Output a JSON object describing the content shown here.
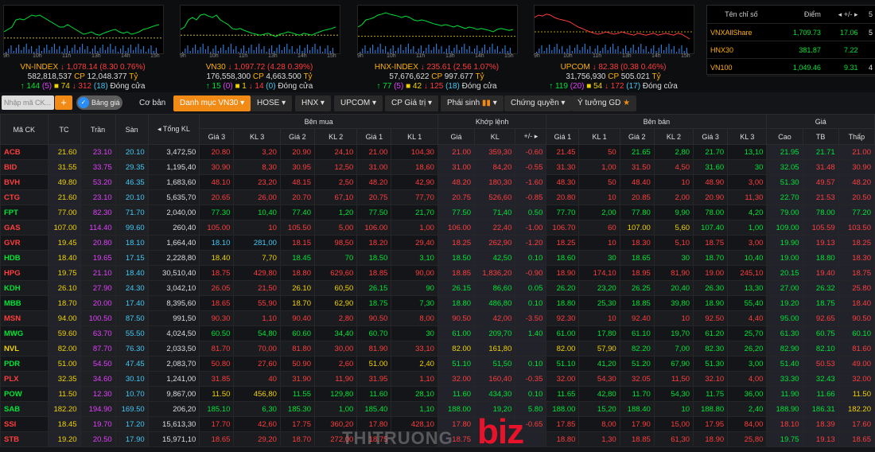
{
  "indices": [
    {
      "id": "vnindex",
      "times": [
        "9h",
        "10h",
        "11h",
        "13h",
        "14h",
        "15h"
      ],
      "ref_ratio": 0.32,
      "line": "0.55,0.50,0.45,0.30,0.28,0.30,0.25,0.20,0.22,0.20,0.25,0.30,0.35,0.40,0.45,0.45,0.40,0.45,0.50,0.55,0.60,0.58,0.55,0.60,0.62,0.58,0.55,0.52,0.50,0.55,0.58,0.55,0.60,0.58,0.55,0.50,0.48,0.45,0.42,0.40",
      "name": "VN-INDEX",
      "value": "1,078.14",
      "change": "(8.30 0.76%)",
      "volume": "582,818,537",
      "value_label": "CP",
      "turnover": "12,048.377",
      "unit": "Tỷ",
      "up": "144",
      "ceil": "(5)",
      "ref": "74",
      "down": "312",
      "floor": "(18)",
      "status": "Đóng cửa"
    },
    {
      "id": "vn30",
      "times": [
        "9h",
        "10h",
        "11h",
        "13h",
        "14h",
        "15h"
      ],
      "ref_ratio": 0.38,
      "line": "0.50,0.45,0.30,0.25,0.30,0.20,0.18,0.22,0.25,0.20,0.30,0.35,0.40,0.48,0.50,0.48,0.52,0.55,0.58,0.60,0.62,0.60,0.58,0.62,0.65,0.60,0.58,0.55,0.57,0.60,0.62,0.58,0.60,0.62,0.58,0.55,0.52,0.50,0.48,0.45",
      "name": "VN30",
      "value": "1,097.72",
      "change": "(4.28 0.39%)",
      "volume": "176,558,300",
      "value_label": "CP",
      "turnover": "4,663.500",
      "unit": "Tỷ",
      "up": "15",
      "ceil": "(0)",
      "ref": "1",
      "down": "14",
      "floor": "(0)",
      "status": "Đóng cửa"
    },
    {
      "id": "hnxindex",
      "times": [
        "9h",
        "10h",
        "11h",
        "13h",
        "14h",
        "15h"
      ],
      "ref_ratio": 0.36,
      "line": "0.45,0.40,0.30,0.28,0.25,0.20,0.18,0.15,0.18,0.20,0.22,0.25,0.22,0.25,0.30,0.32,0.30,0.32,0.35,0.38,0.40,0.42,0.40,0.42,0.45,0.42,0.45,0.48,0.45,0.47,0.50,0.48,0.50,0.52,0.55,0.50,0.48,0.50,0.52,0.50",
      "name": "HNX-INDEX",
      "value": "235.61",
      "change": "(2.56 1.07%)",
      "volume": "57,676,622",
      "value_label": "CP",
      "turnover": "997.677",
      "unit": "Tỷ",
      "up": "77",
      "ceil": "(5)",
      "ref": "42",
      "down": "125",
      "floor": "(18)",
      "status": "Đóng cửa"
    },
    {
      "id": "upcom",
      "times": [
        "9h",
        "10h",
        "11h",
        "13h",
        "14h",
        "15h"
      ],
      "ref_ratio": 0.45,
      "line": "0.25,0.20,0.22,0.18,0.20,0.25,0.28,0.30,0.32,0.35,0.40,0.45,0.48,0.52,0.55,0.58,0.60,0.58,0.55,0.58,0.60,0.58,0.55,0.58,0.60,0.62,0.58,0.60,0.62,0.60,0.58,0.62,0.60,0.58,0.60,0.62,0.58,0.60,0.65,0.70",
      "name": "UPCOM",
      "value": "82.38",
      "change": "(0.38 0.46%)",
      "volume": "31,756,930",
      "value_label": "CP",
      "turnover": "505.021",
      "unit": "Tỷ",
      "up": "119",
      "ceil": "(20)",
      "ref": "54",
      "down": "172",
      "floor": "(17)",
      "status": "Đóng cửa"
    }
  ],
  "side_panel": {
    "headers": [
      "Tên chỉ số",
      "Điểm",
      "+/-",
      "5"
    ],
    "rows": [
      {
        "name": "VNXAllShare",
        "point": "1,709.73",
        "change": "17.06",
        "extra": "5"
      },
      {
        "name": "HNX30",
        "point": "381.87",
        "change": "7.22",
        "extra": ""
      },
      {
        "name": "VN100",
        "point": "1,049.46",
        "change": "9.31",
        "extra": "4"
      }
    ]
  },
  "toolbar": {
    "search_placeholder": "Nhập mã CK...",
    "plus_label": "+",
    "toggle_label": "Bảng giá",
    "basic_label": "Cơ bản",
    "active_tab": "Danh mục VN30",
    "tabs": [
      "HOSE",
      "HNX",
      "UPCOM",
      "CP Giá trị",
      "Phái sinh",
      "Chứng quyền"
    ],
    "idea_label": "Ý tưởng GD"
  },
  "table": {
    "groups": {
      "buy": "Bên mua",
      "match": "Khớp lệnh",
      "sell": "Bên bán",
      "price": "Giá"
    },
    "headers": {
      "symbol": "Mã CK",
      "ref": "TC",
      "ceil": "Trần",
      "floor": "Sàn",
      "total_vol": "Tổng KL",
      "b3": "Giá 3",
      "bv3": "KL 3",
      "b2": "Giá 2",
      "bv2": "KL 2",
      "b1": "Giá 1",
      "bv1": "KL 1",
      "mp": "Giá",
      "mv": "KL",
      "ch": "+/-",
      "s1": "Giá 1",
      "sv1": "KL 1",
      "s2": "Giá 2",
      "sv2": "KL 2",
      "s3": "Giá 3",
      "sv3": "KL 3",
      "high": "Cao",
      "avg": "TB",
      "low": "Thấp"
    },
    "rows": [
      {
        "sym": "ACB",
        "tc": "21.60",
        "tr": "23.10",
        "sn": "20.10",
        "tkl": "3,472,50",
        "b3": "20.80",
        "bv3": "3,20",
        "b2": "20.90",
        "bv2": "24,10",
        "b1": "21.00",
        "bv1": "104,30",
        "mp": "21.00",
        "mv": "359,30",
        "ch": "-0.60",
        "s1": "21.45",
        "sv1": "50",
        "s2": "21.65",
        "sv2": "2,80",
        "s3": "21.70",
        "sv3": "13,10",
        "hi": "21.95",
        "av": "21.71",
        "lo": "21.00"
      },
      {
        "sym": "BID",
        "tc": "31.55",
        "tr": "33.75",
        "sn": "29.35",
        "tkl": "1,195,40",
        "b3": "30.90",
        "bv3": "8,30",
        "b2": "30.95",
        "bv2": "12,50",
        "b1": "31.00",
        "bv1": "18,60",
        "mp": "31.00",
        "mv": "84,20",
        "ch": "-0.55",
        "s1": "31.30",
        "sv1": "1,00",
        "s2": "31.50",
        "sv2": "4,50",
        "s3": "31.60",
        "sv3": "30",
        "hi": "32.05",
        "av": "31.48",
        "lo": "30.90"
      },
      {
        "sym": "BVH",
        "tc": "49.80",
        "tr": "53.20",
        "sn": "46.35",
        "tkl": "1,683,60",
        "b3": "48.10",
        "bv3": "23,20",
        "b2": "48.15",
        "bv2": "2,50",
        "b1": "48.20",
        "bv1": "42,90",
        "mp": "48.20",
        "mv": "180,30",
        "ch": "-1.60",
        "s1": "48.30",
        "sv1": "50",
        "s2": "48.40",
        "sv2": "10",
        "s3": "48.90",
        "sv3": "3,00",
        "hi": "51.30",
        "av": "49.57",
        "lo": "48.20"
      },
      {
        "sym": "CTG",
        "tc": "21.60",
        "tr": "23.10",
        "sn": "20.10",
        "tkl": "5,635,70",
        "b3": "20.65",
        "bv3": "26,00",
        "b2": "20.70",
        "bv2": "67,10",
        "b1": "20.75",
        "bv1": "77,70",
        "mp": "20.75",
        "mv": "526,60",
        "ch": "-0.85",
        "s1": "20.80",
        "sv1": "10",
        "s2": "20.85",
        "sv2": "2,00",
        "s3": "20.90",
        "sv3": "11,30",
        "hi": "22.70",
        "av": "21.53",
        "lo": "20.50"
      },
      {
        "sym": "FPT",
        "tc": "77.00",
        "tr": "82.30",
        "sn": "71.70",
        "tkl": "2,040,00",
        "b3": "77.30",
        "bv3": "10,40",
        "b2": "77.40",
        "bv2": "1,20",
        "b1": "77.50",
        "bv1": "21,70",
        "mp": "77.50",
        "mv": "71,40",
        "ch": "0.50",
        "s1": "77.70",
        "sv1": "2,00",
        "s2": "77.80",
        "sv2": "9,90",
        "s3": "78.00",
        "sv3": "4,20",
        "hi": "79.00",
        "av": "78.00",
        "lo": "77.20"
      },
      {
        "sym": "GAS",
        "tc": "107.00",
        "tr": "114.40",
        "sn": "99.60",
        "tkl": "260,40",
        "b3": "105.00",
        "bv3": "10",
        "b2": "105.50",
        "bv2": "5,00",
        "b1": "106.00",
        "bv1": "1,00",
        "mp": "106.00",
        "mv": "22,40",
        "ch": "-1.00",
        "s1": "106.70",
        "sv1": "60",
        "s2": "107.00",
        "sv2": "5,60",
        "s3": "107.40",
        "sv3": "1,00",
        "hi": "109.00",
        "av": "105.59",
        "lo": "103.50"
      },
      {
        "sym": "GVR",
        "tc": "19.45",
        "tr": "20.80",
        "sn": "18.10",
        "tkl": "1,664,40",
        "b3": "18.10",
        "bv3": "281,00",
        "b2": "18.15",
        "bv2": "98,50",
        "b1": "18.20",
        "bv1": "29,40",
        "mp": "18.25",
        "mv": "262,90",
        "ch": "-1.20",
        "s1": "18.25",
        "sv1": "10",
        "s2": "18.30",
        "sv2": "5,10",
        "s3": "18.75",
        "sv3": "3,00",
        "hi": "19.90",
        "av": "19.13",
        "lo": "18.25"
      },
      {
        "sym": "HDB",
        "tc": "18.40",
        "tr": "19.65",
        "sn": "17.15",
        "tkl": "2,228,80",
        "b3": "18.40",
        "bv3": "7,70",
        "b2": "18.45",
        "bv2": "70",
        "b1": "18.50",
        "bv1": "3,10",
        "mp": "18.50",
        "mv": "42,50",
        "ch": "0.10",
        "s1": "18.60",
        "sv1": "30",
        "s2": "18.65",
        "sv2": "30",
        "s3": "18.70",
        "sv3": "10,40",
        "hi": "19.00",
        "av": "18.80",
        "lo": "18.30"
      },
      {
        "sym": "HPG",
        "tc": "19.75",
        "tr": "21.10",
        "sn": "18.40",
        "tkl": "30,510,40",
        "b3": "18.75",
        "bv3": "429,80",
        "b2": "18.80",
        "bv2": "629,60",
        "b1": "18.85",
        "bv1": "90,00",
        "mp": "18.85",
        "mv": "1,836,20",
        "ch": "-0.90",
        "s1": "18.90",
        "sv1": "174,10",
        "s2": "18.95",
        "sv2": "81,90",
        "s3": "19.00",
        "sv3": "245,10",
        "hi": "20.15",
        "av": "19.40",
        "lo": "18.75"
      },
      {
        "sym": "KDH",
        "tc": "26.10",
        "tr": "27.90",
        "sn": "24.30",
        "tkl": "3,042,10",
        "b3": "26.05",
        "bv3": "21,50",
        "b2": "26.10",
        "bv2": "60,50",
        "b1": "26.15",
        "bv1": "90",
        "mp": "26.15",
        "mv": "86,60",
        "ch": "0.05",
        "s1": "26.20",
        "sv1": "23,20",
        "s2": "26.25",
        "sv2": "20,40",
        "s3": "26.30",
        "sv3": "13,30",
        "hi": "27.00",
        "av": "26.32",
        "lo": "25.80"
      },
      {
        "sym": "MBB",
        "tc": "18.70",
        "tr": "20.00",
        "sn": "17.40",
        "tkl": "8,395,60",
        "b3": "18.65",
        "bv3": "55,90",
        "b2": "18.70",
        "bv2": "62,90",
        "b1": "18.75",
        "bv1": "7,30",
        "mp": "18.80",
        "mv": "486,80",
        "ch": "0.10",
        "s1": "18.80",
        "sv1": "25,30",
        "s2": "18.85",
        "sv2": "39,80",
        "s3": "18.90",
        "sv3": "55,40",
        "hi": "19.20",
        "av": "18.75",
        "lo": "18.40"
      },
      {
        "sym": "MSN",
        "tc": "94.00",
        "tr": "100.50",
        "sn": "87.50",
        "tkl": "991,50",
        "b3": "90.30",
        "bv3": "1,10",
        "b2": "90.40",
        "bv2": "2,80",
        "b1": "90.50",
        "bv1": "8,00",
        "mp": "90.50",
        "mv": "42,00",
        "ch": "-3.50",
        "s1": "92.30",
        "sv1": "10",
        "s2": "92.40",
        "sv2": "10",
        "s3": "92.50",
        "sv3": "4,40",
        "hi": "95.00",
        "av": "92.65",
        "lo": "90.50"
      },
      {
        "sym": "MWG",
        "tc": "59.60",
        "tr": "63.70",
        "sn": "55.50",
        "tkl": "4,024,50",
        "b3": "60.50",
        "bv3": "54,80",
        "b2": "60.60",
        "bv2": "34,40",
        "b1": "60.70",
        "bv1": "30",
        "mp": "61.00",
        "mv": "209,70",
        "ch": "1.40",
        "s1": "61.00",
        "sv1": "17,80",
        "s2": "61.10",
        "sv2": "19,70",
        "s3": "61.20",
        "sv3": "25,70",
        "hi": "61.30",
        "av": "60.75",
        "lo": "60.10"
      },
      {
        "sym": "NVL",
        "tc": "82.00",
        "tr": "87.70",
        "sn": "76.30",
        "tkl": "2,033,50",
        "b3": "81.70",
        "bv3": "70,00",
        "b2": "81.80",
        "bv2": "30,00",
        "b1": "81.90",
        "bv1": "33,10",
        "mp": "82.00",
        "mv": "161,80",
        "ch": "",
        "s1": "82.00",
        "sv1": "57,90",
        "s2": "82.20",
        "sv2": "7,00",
        "s3": "82.30",
        "sv3": "26,20",
        "hi": "82.90",
        "av": "82.10",
        "lo": "81.60"
      },
      {
        "sym": "PDR",
        "tc": "51.00",
        "tr": "54.50",
        "sn": "47.45",
        "tkl": "2,083,70",
        "b3": "50.80",
        "bv3": "27,60",
        "b2": "50.90",
        "bv2": "2,60",
        "b1": "51.00",
        "bv1": "2,40",
        "mp": "51.10",
        "mv": "51,50",
        "ch": "0.10",
        "s1": "51.10",
        "sv1": "41,20",
        "s2": "51.20",
        "sv2": "67,90",
        "s3": "51.30",
        "sv3": "3,00",
        "hi": "51.40",
        "av": "50.53",
        "lo": "49.00"
      },
      {
        "sym": "PLX",
        "tc": "32.35",
        "tr": "34.60",
        "sn": "30.10",
        "tkl": "1,241,00",
        "b3": "31.85",
        "bv3": "40",
        "b2": "31.90",
        "bv2": "11,90",
        "b1": "31.95",
        "bv1": "1,10",
        "mp": "32.00",
        "mv": "160,40",
        "ch": "-0.35",
        "s1": "32.00",
        "sv1": "54,30",
        "s2": "32.05",
        "sv2": "11,50",
        "s3": "32.10",
        "sv3": "4,00",
        "hi": "33.30",
        "av": "32.43",
        "lo": "32.00"
      },
      {
        "sym": "POW",
        "tc": "11.50",
        "tr": "12.30",
        "sn": "10.70",
        "tkl": "9,867,00",
        "b3": "11.50",
        "bv3": "456,80",
        "b2": "11.55",
        "bv2": "129,80",
        "b1": "11.60",
        "bv1": "28,10",
        "mp": "11.60",
        "mv": "434,30",
        "ch": "0.10",
        "s1": "11.65",
        "sv1": "42,80",
        "s2": "11.70",
        "sv2": "54,30",
        "s3": "11.75",
        "sv3": "36,00",
        "hi": "11.90",
        "av": "11.66",
        "lo": "11.50"
      },
      {
        "sym": "SAB",
        "tc": "182.20",
        "tr": "194.90",
        "sn": "169.50",
        "tkl": "206,20",
        "b3": "185.10",
        "bv3": "6,30",
        "b2": "185.30",
        "bv2": "1,00",
        "b1": "185.40",
        "bv1": "1,10",
        "mp": "188.00",
        "mv": "19,20",
        "ch": "5.80",
        "s1": "188.00",
        "sv1": "15,20",
        "s2": "188.40",
        "sv2": "10",
        "s3": "188.80",
        "sv3": "2,40",
        "hi": "188.90",
        "av": "186.31",
        "lo": "182.20"
      },
      {
        "sym": "SSI",
        "tc": "18.45",
        "tr": "19.70",
        "sn": "17.20",
        "tkl": "15,613,30",
        "b3": "17.70",
        "bv3": "42,60",
        "b2": "17.75",
        "bv2": "360,20",
        "b1": "17.80",
        "bv1": "428,10",
        "mp": "17.80",
        "mv": "",
        "ch": "-0.65",
        "s1": "17.85",
        "sv1": "8,00",
        "s2": "17.90",
        "sv2": "15,00",
        "s3": "17.95",
        "sv3": "84,00",
        "hi": "18.10",
        "av": "18.39",
        "lo": "17.60"
      },
      {
        "sym": "STB",
        "tc": "19.20",
        "tr": "20.50",
        "sn": "17.90",
        "tkl": "15,971,10",
        "b3": "18.65",
        "bv3": "29,20",
        "b2": "18.70",
        "bv2": "272,00",
        "b1": "18.75",
        "bv1": "",
        "mp": "18.75",
        "mv": "",
        "ch": "",
        "s1": "18.80",
        "sv1": "1,30",
        "s2": "18.85",
        "sv2": "61,30",
        "s3": "18.90",
        "sv3": "25,80",
        "hi": "19.75",
        "av": "19.13",
        "lo": "18.65"
      }
    ]
  },
  "watermark": {
    "left": "THITRUONG",
    "right": "biz"
  },
  "colors": {
    "up": "#00e436",
    "down": "#ff3d3d",
    "ref": "#f0d200",
    "ceil": "#e040fb",
    "floor": "#42c8f4",
    "accent": "#f28a16"
  }
}
